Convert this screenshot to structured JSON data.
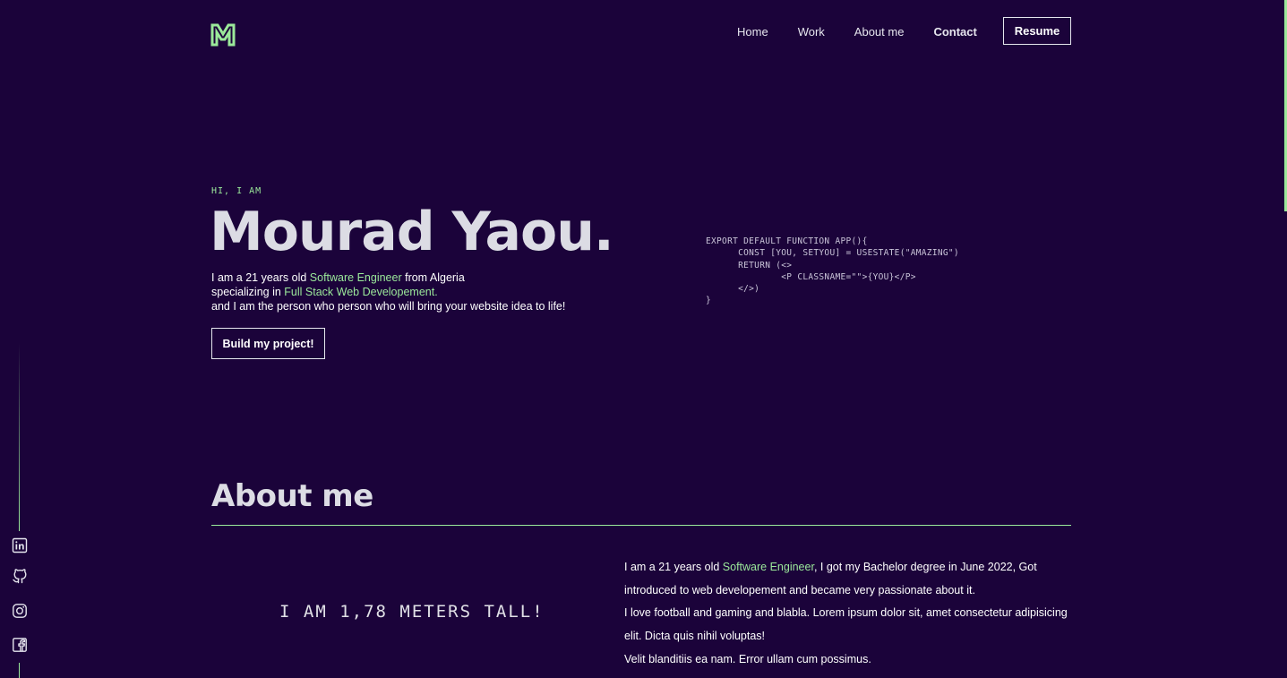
{
  "colors": {
    "background": "#1b033a",
    "accent": "#9be99a",
    "text": "#e6e6ee"
  },
  "nav": {
    "logo_icon": "my-monogram-logo",
    "links": [
      "Home",
      "Work",
      "About me",
      "Contact"
    ],
    "active_link": "Contact",
    "resume_label": "Resume"
  },
  "hero": {
    "greeting": "HI, I AM",
    "name": "Mourad Yaou.",
    "desc_line1_pre": "I am a 21 years old ",
    "desc_line1_accent": "Software Engineer",
    "desc_line1_post": " from Algeria",
    "desc_line2_pre": "specializing in ",
    "desc_line2_accent": "Full Stack Web Developement",
    "desc_line2_post": ".",
    "desc_line3": "and I am the person who person who will bring your website idea to life!",
    "cta_label": "Build my project!"
  },
  "code": {
    "line1": "EXPORT DEFAULT FUNCTION APP(){",
    "line2": "      CONST [YOU, SETYOU] = USESTATE(\"AMAZING\")",
    "line3": "      RETURN (<>",
    "line4": "              <P CLASSNAME=\"\">{YOU}</P>",
    "line5": "      </>)",
    "line6": "}"
  },
  "about": {
    "title": "About me",
    "fact": "I AM 1,78 METERS TALL!",
    "p1_pre": "I am a 21 years old ",
    "p1_accent": "Software Engineer",
    "p1_post": ", I got my Bachelor degree in June 2022, Got introduced to web developement and became very passionate about it.",
    "p2": "I love football and gaming and blabla. Lorem ipsum dolor sit, amet consectetur adipisicing elit. Dicta quis nihil voluptas!",
    "p3": "Velit blanditiis ea nam. Error ullam cum possimus."
  },
  "social": {
    "icons": [
      "linkedin-icon",
      "github-icon",
      "instagram-icon",
      "facebook-icon"
    ]
  },
  "scrollbar": {
    "position": 0
  }
}
